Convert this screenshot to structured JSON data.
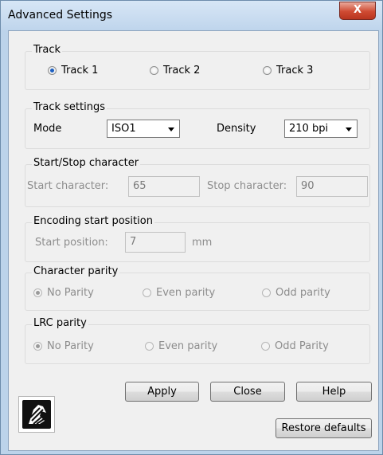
{
  "window": {
    "title": "Advanced Settings",
    "close_label": "X"
  },
  "track": {
    "legend": "Track",
    "options": [
      {
        "label": "Track 1",
        "selected": true
      },
      {
        "label": "Track 2",
        "selected": false
      },
      {
        "label": "Track 3",
        "selected": false
      }
    ]
  },
  "track_settings": {
    "legend": "Track settings",
    "mode_label": "Mode",
    "mode_value": "ISO1",
    "density_label": "Density",
    "density_value": "210 bpi"
  },
  "start_stop": {
    "legend": "Start/Stop character",
    "start_label": "Start character:",
    "start_value": "65",
    "stop_label": "Stop character:",
    "stop_value": "90"
  },
  "encoding": {
    "legend": "Encoding start position",
    "position_label": "Start position:",
    "position_value": "7",
    "unit": "mm"
  },
  "char_parity": {
    "legend": "Character parity",
    "options": [
      {
        "label": "No Parity",
        "selected": true
      },
      {
        "label": "Even parity",
        "selected": false
      },
      {
        "label": "Odd parity",
        "selected": false
      }
    ]
  },
  "lrc_parity": {
    "legend": "LRC parity",
    "options": [
      {
        "label": "No Parity",
        "selected": true
      },
      {
        "label": "Even parity",
        "selected": false
      },
      {
        "label": "Odd Parity",
        "selected": false
      }
    ]
  },
  "buttons": {
    "apply": "Apply",
    "close": "Close",
    "help": "Help",
    "restore": "Restore defaults"
  },
  "logo": {
    "icon": "zebra-logo-icon"
  }
}
